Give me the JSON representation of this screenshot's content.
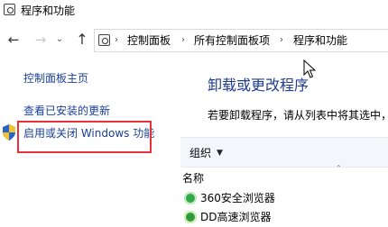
{
  "window": {
    "title": "程序和功能"
  },
  "navigation": {
    "back_icon": "back-arrow-icon",
    "forward_icon": "forward-arrow-icon",
    "recent_icon": "dropdown-chevron-icon",
    "up_icon": "up-arrow-icon",
    "breadcrumbs": [
      "控制面板",
      "所有控制面板项",
      "程序和功能"
    ]
  },
  "sidebar": {
    "items": [
      {
        "label": "控制面板主页"
      },
      {
        "label": "查看已安装的更新"
      },
      {
        "label": "启用或关闭 Windows 功能",
        "icon": "shield-icon"
      }
    ]
  },
  "main": {
    "title": "卸载或更改程序",
    "description": "若要卸载程序，请从列表中将其选中，"
  },
  "toolbar": {
    "organize_label": "组织"
  },
  "list": {
    "column_name": "名称",
    "programs": [
      {
        "name": "360安全浏览器",
        "icon": "360-browser-icon"
      },
      {
        "name": "DD高速浏览器",
        "icon": "dd-browser-icon"
      }
    ]
  },
  "colors": {
    "link": "#1a3f9a",
    "title": "#1e3c8f",
    "highlight_border": "#e8323a",
    "toolbar_bg": "#f3f6fb"
  }
}
